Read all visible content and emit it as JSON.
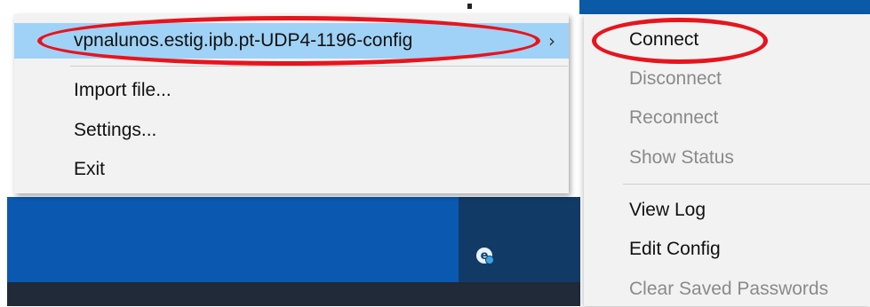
{
  "main_menu": {
    "items": [
      {
        "label": "vpnalunos.estig.ipb.pt-UDP4-1196-config",
        "has_submenu": true,
        "highlighted": true
      },
      {
        "label": "Import file..."
      },
      {
        "label": "Settings..."
      },
      {
        "label": "Exit"
      }
    ],
    "submenu_arrow": "›"
  },
  "submenu": {
    "items": [
      {
        "label": "Connect",
        "enabled": true
      },
      {
        "label": "Disconnect",
        "enabled": false
      },
      {
        "label": "Reconnect",
        "enabled": false
      },
      {
        "label": "Show Status",
        "enabled": false
      },
      {
        "label": "View Log",
        "enabled": true
      },
      {
        "label": "Edit Config",
        "enabled": true
      },
      {
        "label": "Clear Saved Passwords",
        "enabled": false
      }
    ]
  },
  "tray": {
    "icon": "e-tray-icon",
    "glyph": "e"
  },
  "annotations": {
    "color": "#e8141c"
  }
}
